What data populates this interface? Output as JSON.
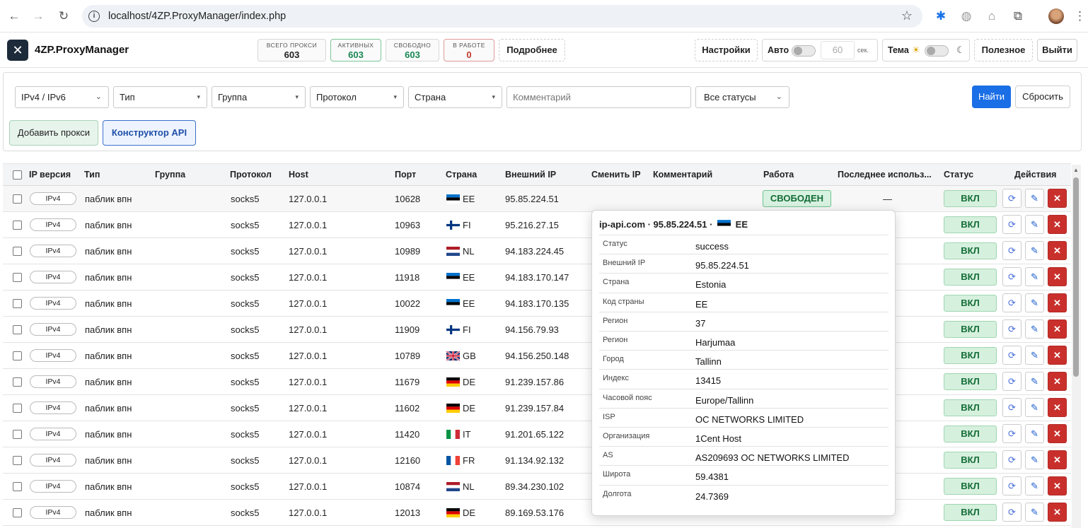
{
  "browser": {
    "url": "localhost/4ZP.ProxyManager/index.php"
  },
  "header": {
    "title": "4ZP.ProxyManager",
    "stats": [
      {
        "label": "ВСЕГО ПРОКСИ",
        "value": "603"
      },
      {
        "label": "АКТИВНЫХ",
        "value": "603"
      },
      {
        "label": "СВОБОДНО",
        "value": "603"
      },
      {
        "label": "В РАБОТЕ",
        "value": "0"
      }
    ],
    "details_label": "Подробнее",
    "settings_label": "Настройки",
    "auto_label": "Авто",
    "auto_seconds": "60",
    "auto_unit": "сек.",
    "theme_label": "Тема",
    "useful_label": "Полезное",
    "logout_label": "Выйти"
  },
  "filters": {
    "ip_version": "IPv4 / IPv6",
    "type": "Тип",
    "group": "Группа",
    "protocol": "Протокол",
    "country": "Страна",
    "comment_placeholder": "Комментарий",
    "status": "Все статусы",
    "find_label": "Найти",
    "reset_label": "Сбросить",
    "add_label": "Добавить прокси",
    "api_label": "Конструктор API"
  },
  "table": {
    "headers": {
      "ipver": "IP версия",
      "type": "Тип",
      "group": "Группа",
      "protocol": "Протокол",
      "host": "Host",
      "port": "Порт",
      "country": "Страна",
      "extip": "Внешний IP",
      "changeip": "Сменить IP",
      "comment": "Комментарий",
      "work": "Работа",
      "lastused": "Последнее использ...",
      "status": "Статус",
      "actions": "Действия"
    },
    "rows": [
      {
        "ipver": "IPv4",
        "type": "паблик впн",
        "protocol": "socks5",
        "host": "127.0.0.1",
        "port": "10628",
        "cc": "EE",
        "extip": "95.85.224.51",
        "work": "СВОБОДЕН",
        "lastused": "—",
        "status": "ВКЛ"
      },
      {
        "ipver": "IPv4",
        "type": "паблик впн",
        "protocol": "socks5",
        "host": "127.0.0.1",
        "port": "10963",
        "cc": "FI",
        "extip": "95.216.27.15",
        "status": "ВКЛ"
      },
      {
        "ipver": "IPv4",
        "type": "паблик впн",
        "protocol": "socks5",
        "host": "127.0.0.1",
        "port": "10989",
        "cc": "NL",
        "extip": "94.183.224.45",
        "status": "ВКЛ"
      },
      {
        "ipver": "IPv4",
        "type": "паблик впн",
        "protocol": "socks5",
        "host": "127.0.0.1",
        "port": "11918",
        "cc": "EE",
        "extip": "94.183.170.147",
        "status": "ВКЛ"
      },
      {
        "ipver": "IPv4",
        "type": "паблик впн",
        "protocol": "socks5",
        "host": "127.0.0.1",
        "port": "10022",
        "cc": "EE",
        "extip": "94.183.170.135",
        "status": "ВКЛ"
      },
      {
        "ipver": "IPv4",
        "type": "паблик впн",
        "protocol": "socks5",
        "host": "127.0.0.1",
        "port": "11909",
        "cc": "FI",
        "extip": "94.156.79.93",
        "status": "ВКЛ"
      },
      {
        "ipver": "IPv4",
        "type": "паблик впн",
        "protocol": "socks5",
        "host": "127.0.0.1",
        "port": "10789",
        "cc": "GB",
        "extip": "94.156.250.148",
        "status": "ВКЛ"
      },
      {
        "ipver": "IPv4",
        "type": "паблик впн",
        "protocol": "socks5",
        "host": "127.0.0.1",
        "port": "11679",
        "cc": "DE",
        "extip": "91.239.157.86",
        "status": "ВКЛ"
      },
      {
        "ipver": "IPv4",
        "type": "паблик впн",
        "protocol": "socks5",
        "host": "127.0.0.1",
        "port": "11602",
        "cc": "DE",
        "extip": "91.239.157.84",
        "status": "ВКЛ"
      },
      {
        "ipver": "IPv4",
        "type": "паблик впн",
        "protocol": "socks5",
        "host": "127.0.0.1",
        "port": "11420",
        "cc": "IT",
        "extip": "91.201.65.122",
        "status": "ВКЛ"
      },
      {
        "ipver": "IPv4",
        "type": "паблик впн",
        "protocol": "socks5",
        "host": "127.0.0.1",
        "port": "12160",
        "cc": "FR",
        "extip": "91.134.92.132",
        "status": "ВКЛ"
      },
      {
        "ipver": "IPv4",
        "type": "паблик впн",
        "protocol": "socks5",
        "host": "127.0.0.1",
        "port": "10874",
        "cc": "NL",
        "extip": "89.34.230.102",
        "status": "ВКЛ"
      },
      {
        "ipver": "IPv4",
        "type": "паблик впн",
        "protocol": "socks5",
        "host": "127.0.0.1",
        "port": "12013",
        "cc": "DE",
        "extip": "89.169.53.176",
        "status": "ВКЛ"
      }
    ]
  },
  "popup": {
    "title_prefix": "ip-api.com · 95.85.224.51 ·",
    "title_cc": "EE",
    "rows": [
      {
        "k": "Статус",
        "v": "success"
      },
      {
        "k": "Внешний IP",
        "v": "95.85.224.51"
      },
      {
        "k": "Страна",
        "v": "Estonia"
      },
      {
        "k": "Код страны",
        "v": "EE"
      },
      {
        "k": "Регион",
        "v": "37"
      },
      {
        "k": "Регион",
        "v": "Harjumaa"
      },
      {
        "k": "Город",
        "v": "Tallinn"
      },
      {
        "k": "Индекс",
        "v": "13415"
      },
      {
        "k": "Часовой пояс",
        "v": "Europe/Tallinn"
      },
      {
        "k": "ISP",
        "v": "OC NETWORKS LIMITED"
      },
      {
        "k": "Организация",
        "v": "1Cent Host"
      },
      {
        "k": "AS",
        "v": "AS209693 OC NETWORKS LIMITED"
      },
      {
        "k": "Широта",
        "v": "59.4381"
      },
      {
        "k": "Долгота",
        "v": "24.7369"
      }
    ]
  },
  "colors": {
    "primary": "#1a6ee6",
    "success": "#198754",
    "danger": "#c9302c"
  }
}
